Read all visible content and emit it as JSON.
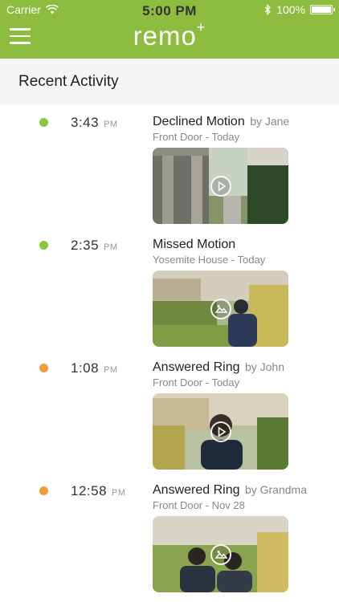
{
  "status_bar": {
    "carrier": "Carrier",
    "time": "5:00 PM",
    "battery": "100%"
  },
  "header": {
    "brand": "remo",
    "brand_mark": "+",
    "accent_color": "#8cbd3f"
  },
  "section": {
    "title": "Recent Activity"
  },
  "activities": [
    {
      "time": "3:43",
      "ampm": "PM",
      "dot_color": "#8cc63f",
      "event": "Declined Motion",
      "by": "by Jane",
      "location": "Front Door - Today",
      "media_icon": "play-icon"
    },
    {
      "time": "2:35",
      "ampm": "PM",
      "dot_color": "#8cc63f",
      "event": "Missed Motion",
      "by": "",
      "location": "Yosemite House - Today",
      "media_icon": "image-icon"
    },
    {
      "time": "1:08",
      "ampm": "PM",
      "dot_color": "#f39a3a",
      "event": "Answered Ring",
      "by": "by John",
      "location": "Front Door  - Today",
      "media_icon": "play-icon"
    },
    {
      "time": "12:58",
      "ampm": "PM",
      "dot_color": "#f39a3a",
      "event": "Answered Ring",
      "by": "by Grandma",
      "location": "Front Door  - Nov 28",
      "media_icon": "image-icon"
    }
  ]
}
